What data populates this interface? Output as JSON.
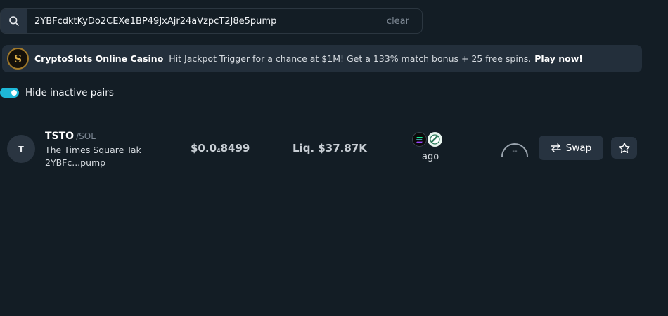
{
  "search": {
    "value": "2YBFcdktKyDo2CEXe1BP49JxAjr24aVzpcT2J8e5pump",
    "clear_label": "clear"
  },
  "banner": {
    "logo_glyph": "$",
    "brand": "CryptoSlots Online Casino",
    "text": "Hit Jackpot Trigger for a chance at $1M! Get a 133% match bonus + 25 free spins.",
    "cta": "Play now!"
  },
  "filter": {
    "label": "Hide inactive pairs",
    "enabled": true
  },
  "pair": {
    "avatar_letter": "T",
    "symbol": "TSTO",
    "separator": "/",
    "quote": "SOL",
    "name": "The Times Square Tak",
    "address": "2YBFc...pump",
    "price_prefix": "$0.0",
    "price_zeros_subscript": "4",
    "price_digits": "8499",
    "liquidity": "Liq. $37.87K",
    "age": "ago",
    "gauge_value": "--",
    "swap_label": "Swap",
    "chain_icon": "solana-icon",
    "dex_icon": "pumpfun-icon"
  },
  "colors": {
    "background": "#131d25",
    "panel": "#232f3b",
    "button": "#273340",
    "accent": "#1eb8d8"
  }
}
